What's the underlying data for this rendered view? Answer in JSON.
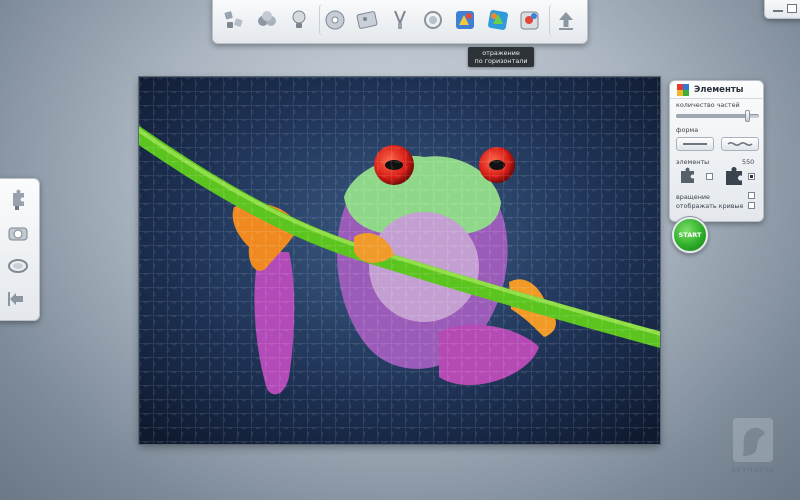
{
  "toolbar": {
    "buttons": [
      {
        "name": "shuffle-pieces",
        "icon": "scatter-icon"
      },
      {
        "name": "group-pieces",
        "icon": "stack-icon"
      },
      {
        "name": "hint",
        "icon": "bulb-icon"
      },
      {
        "name": "music",
        "icon": "disc-icon"
      },
      {
        "name": "preview",
        "icon": "photo-icon"
      },
      {
        "name": "tools",
        "icon": "tools-icon"
      },
      {
        "name": "rotate",
        "icon": "rotate-icon"
      },
      {
        "name": "mirror-horizontal",
        "icon": "mirror-h-icon"
      },
      {
        "name": "mirror-vertical",
        "icon": "mirror-v-icon"
      },
      {
        "name": "mirror-rotate",
        "icon": "mirror-rotate-icon"
      },
      {
        "name": "up",
        "icon": "arrow-up-icon"
      }
    ]
  },
  "tooltip": {
    "line1": "отражение",
    "line2": "по горизонтали"
  },
  "left_toolbar": {
    "buttons": [
      {
        "name": "piece-tool",
        "icon": "piece-icon"
      },
      {
        "name": "camera",
        "icon": "camera-icon"
      },
      {
        "name": "rotate-view",
        "icon": "rings-icon"
      },
      {
        "name": "back",
        "icon": "arrow-back-icon"
      }
    ]
  },
  "elements_panel": {
    "title": "Элементы",
    "piece_count_label": "количество частей",
    "piece_count_fraction": 0.86,
    "shape_label": "форма",
    "pieces_label": "элементы",
    "max_count": "550",
    "rotation_label": "вращение",
    "curves_label": "отображать кривые",
    "rotation_checked": false,
    "curves_checked": false
  },
  "start_label": "START",
  "logo_text": "SKYHORSE",
  "colors": {
    "accent": "#2fae2a",
    "background": "#aab5c1",
    "tooltip": "#2e3338"
  }
}
